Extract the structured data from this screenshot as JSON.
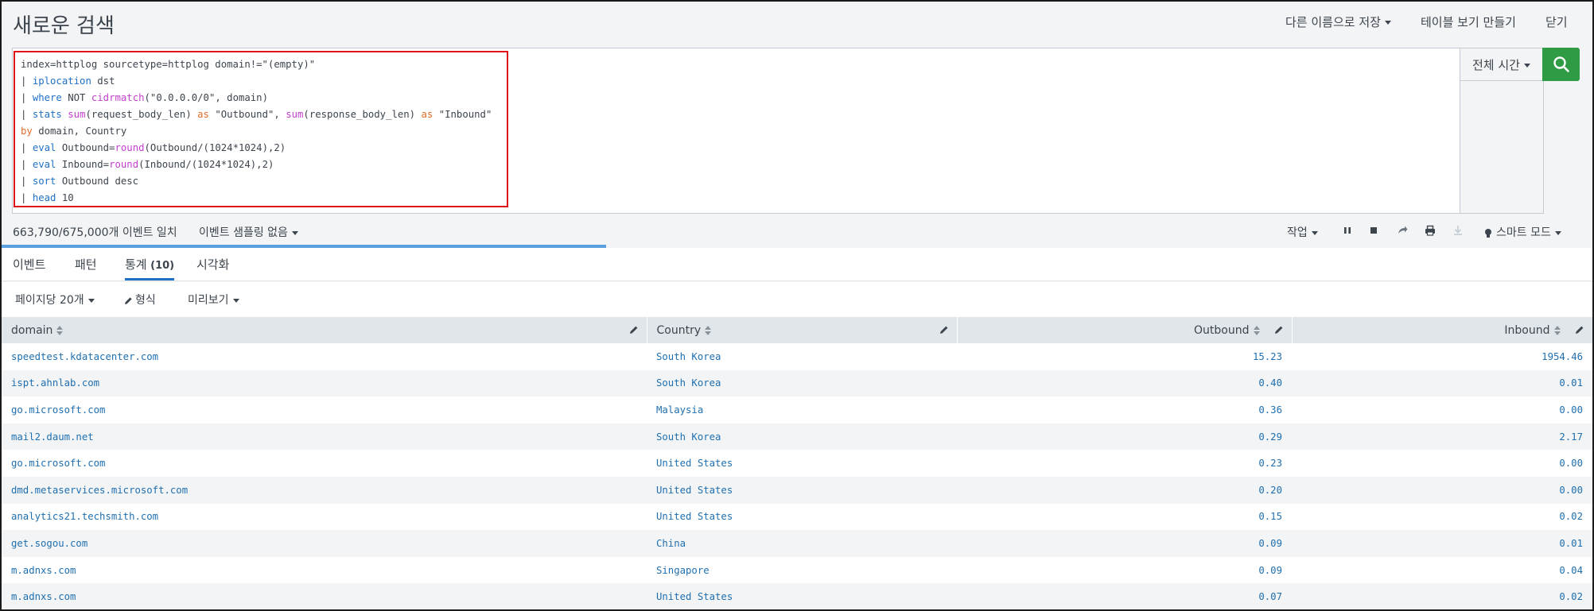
{
  "header": {
    "title": "새로운 검색",
    "save_as": "다른 이름으로 저장",
    "create_table_view": "테이블 보기 만들기",
    "close": "닫기"
  },
  "search": {
    "query_lines": [
      [
        {
          "t": "index=httplog sourcetype=httplog domain!=\"(empty)\"",
          "c": ""
        }
      ],
      [
        {
          "t": "| ",
          "c": ""
        },
        {
          "t": "iplocation",
          "c": "cmd"
        },
        {
          "t": " dst",
          "c": ""
        }
      ],
      [
        {
          "t": "| ",
          "c": ""
        },
        {
          "t": "where",
          "c": "cmd"
        },
        {
          "t": " NOT ",
          "c": ""
        },
        {
          "t": "cidrmatch",
          "c": "fn"
        },
        {
          "t": "(\"0.0.0.0/0\", domain)",
          "c": ""
        }
      ],
      [
        {
          "t": "| ",
          "c": ""
        },
        {
          "t": "stats",
          "c": "cmd"
        },
        {
          "t": " ",
          "c": ""
        },
        {
          "t": "sum",
          "c": "fn"
        },
        {
          "t": "(request_body_len) ",
          "c": ""
        },
        {
          "t": "as",
          "c": "op"
        },
        {
          "t": " \"Outbound\", ",
          "c": ""
        },
        {
          "t": "sum",
          "c": "fn"
        },
        {
          "t": "(response_body_len) ",
          "c": ""
        },
        {
          "t": "as",
          "c": "op"
        },
        {
          "t": " \"Inbound\"",
          "c": ""
        }
      ],
      [
        {
          "t": "by",
          "c": "op"
        },
        {
          "t": " domain, Country",
          "c": ""
        }
      ],
      [
        {
          "t": "| ",
          "c": ""
        },
        {
          "t": "eval",
          "c": "cmd"
        },
        {
          "t": " Outbound=",
          "c": ""
        },
        {
          "t": "round",
          "c": "fn"
        },
        {
          "t": "(Outbound/(1024*1024),2)",
          "c": ""
        }
      ],
      [
        {
          "t": "| ",
          "c": ""
        },
        {
          "t": "eval",
          "c": "cmd"
        },
        {
          "t": " Inbound=",
          "c": ""
        },
        {
          "t": "round",
          "c": "fn"
        },
        {
          "t": "(Inbound/(1024*1024),2)",
          "c": ""
        }
      ],
      [
        {
          "t": "| ",
          "c": ""
        },
        {
          "t": "sort",
          "c": "cmd"
        },
        {
          "t": " Outbound desc",
          "c": ""
        }
      ],
      [
        {
          "t": "| ",
          "c": ""
        },
        {
          "t": "head",
          "c": "cmd"
        },
        {
          "t": " 10",
          "c": ""
        }
      ]
    ],
    "time_range": "전체 시간",
    "search_icon": "search-icon"
  },
  "status": {
    "event_count": "663,790/675,000개 이벤트 일치",
    "sampling": "이벤트 샘플링 없음",
    "job": "작업",
    "smart_mode": "스마트 모드",
    "progress": 0.38
  },
  "tabs": [
    {
      "label": "이벤트",
      "count": "",
      "active": false
    },
    {
      "label": "패턴",
      "count": "",
      "active": false
    },
    {
      "label": "통계",
      "count": "(10)",
      "active": true
    },
    {
      "label": "시각화",
      "count": "",
      "active": false
    }
  ],
  "controls": {
    "per_page": "페이지당 20개",
    "format": "형식",
    "preview": "미리보기"
  },
  "table": {
    "columns": [
      "domain",
      "Country",
      "Outbound",
      "Inbound"
    ],
    "rows": [
      [
        "speedtest.kdatacenter.com",
        "South Korea",
        "15.23",
        "1954.46"
      ],
      [
        "ispt.ahnlab.com",
        "South Korea",
        "0.40",
        "0.01"
      ],
      [
        "go.microsoft.com",
        "Malaysia",
        "0.36",
        "0.00"
      ],
      [
        "mail2.daum.net",
        "South Korea",
        "0.29",
        "2.17"
      ],
      [
        "go.microsoft.com",
        "United States",
        "0.23",
        "0.00"
      ],
      [
        "dmd.metaservices.microsoft.com",
        "United States",
        "0.20",
        "0.00"
      ],
      [
        "analytics21.techsmith.com",
        "United States",
        "0.15",
        "0.02"
      ],
      [
        "get.sogou.com",
        "China",
        "0.09",
        "0.01"
      ],
      [
        "m.adnxs.com",
        "Singapore",
        "0.09",
        "0.04"
      ],
      [
        "m.adnxs.com",
        "United States",
        "0.07",
        "0.02"
      ]
    ]
  },
  "colors": {
    "accent": "#1f70c5",
    "search_button": "#2f9b44",
    "highlight": "#e0151a",
    "link": "#1f6fb0"
  }
}
